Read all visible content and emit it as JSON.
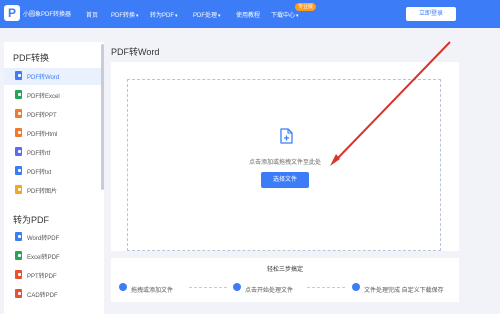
{
  "header": {
    "brand": "小圆象PDF转换器",
    "nav": [
      {
        "label": "首页",
        "dropdown": false
      },
      {
        "label": "PDF转换",
        "dropdown": true
      },
      {
        "label": "转为PDF",
        "dropdown": true
      },
      {
        "label": "PDF处理",
        "dropdown": true
      },
      {
        "label": "使用教程",
        "dropdown": false
      },
      {
        "label": "下载中心",
        "dropdown": true
      }
    ],
    "hot_badge": "专业版",
    "login": "立即登录"
  },
  "sidebar": {
    "sections": [
      {
        "title": "PDF转换",
        "items": [
          {
            "label": "PDF转Word",
            "icon": "word-doc-icon",
            "color": "#3d7cf7",
            "active": true
          },
          {
            "label": "PDF转Excel",
            "icon": "excel-doc-icon",
            "color": "#29a35a"
          },
          {
            "label": "PDF转PPT",
            "icon": "ppt-doc-icon",
            "color": "#f07b2e"
          },
          {
            "label": "PDF转Html",
            "icon": "html-doc-icon",
            "color": "#f07b2e"
          },
          {
            "label": "PDF转rtf",
            "icon": "rtf-doc-icon",
            "color": "#5b6cf0"
          },
          {
            "label": "PDF转txt",
            "icon": "txt-doc-icon",
            "color": "#3d7cf7"
          },
          {
            "label": "PDF转图片",
            "icon": "image-doc-icon",
            "color": "#f5a623"
          }
        ]
      },
      {
        "title": "转为PDF",
        "items": [
          {
            "label": "Word转PDF",
            "icon": "word-to-pdf-icon",
            "color": "#3d7cf7"
          },
          {
            "label": "Excel转PDF",
            "icon": "excel-to-pdf-icon",
            "color": "#29a35a"
          },
          {
            "label": "PPT转PDF",
            "icon": "ppt-to-pdf-icon",
            "color": "#e8502e"
          },
          {
            "label": "CAD转PDF",
            "icon": "cad-to-pdf-icon",
            "color": "#e8502e"
          }
        ]
      }
    ]
  },
  "main": {
    "title": "PDF转Word",
    "upload_hint": "点击添加或拖拽文件至此处",
    "choose_button": "选择文件",
    "steps_title": "轻松三步搞定",
    "steps": [
      {
        "label": "拖拽或添加文件",
        "icon": "upload-step-icon"
      },
      {
        "label": "点击开始处理文件",
        "icon": "process-step-icon"
      },
      {
        "label": "文件处理完成 自定义下载保存",
        "icon": "download-step-icon"
      }
    ]
  },
  "colors": {
    "accent": "#3d7cf7",
    "annotation_arrow": "#d9342b"
  }
}
